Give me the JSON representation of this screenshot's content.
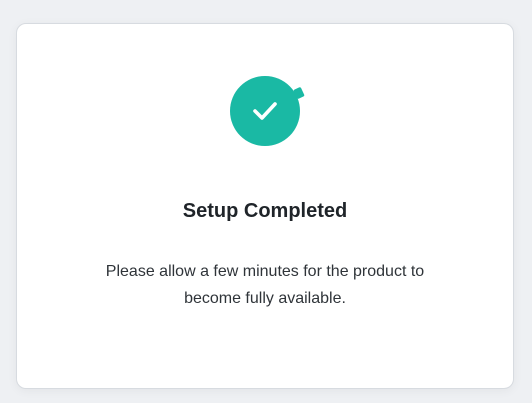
{
  "dialog": {
    "icon": "check-circle-icon",
    "accent_color": "#1ab9a4",
    "title": "Setup Completed",
    "message": "Please allow a few minutes for the product to become fully available."
  }
}
